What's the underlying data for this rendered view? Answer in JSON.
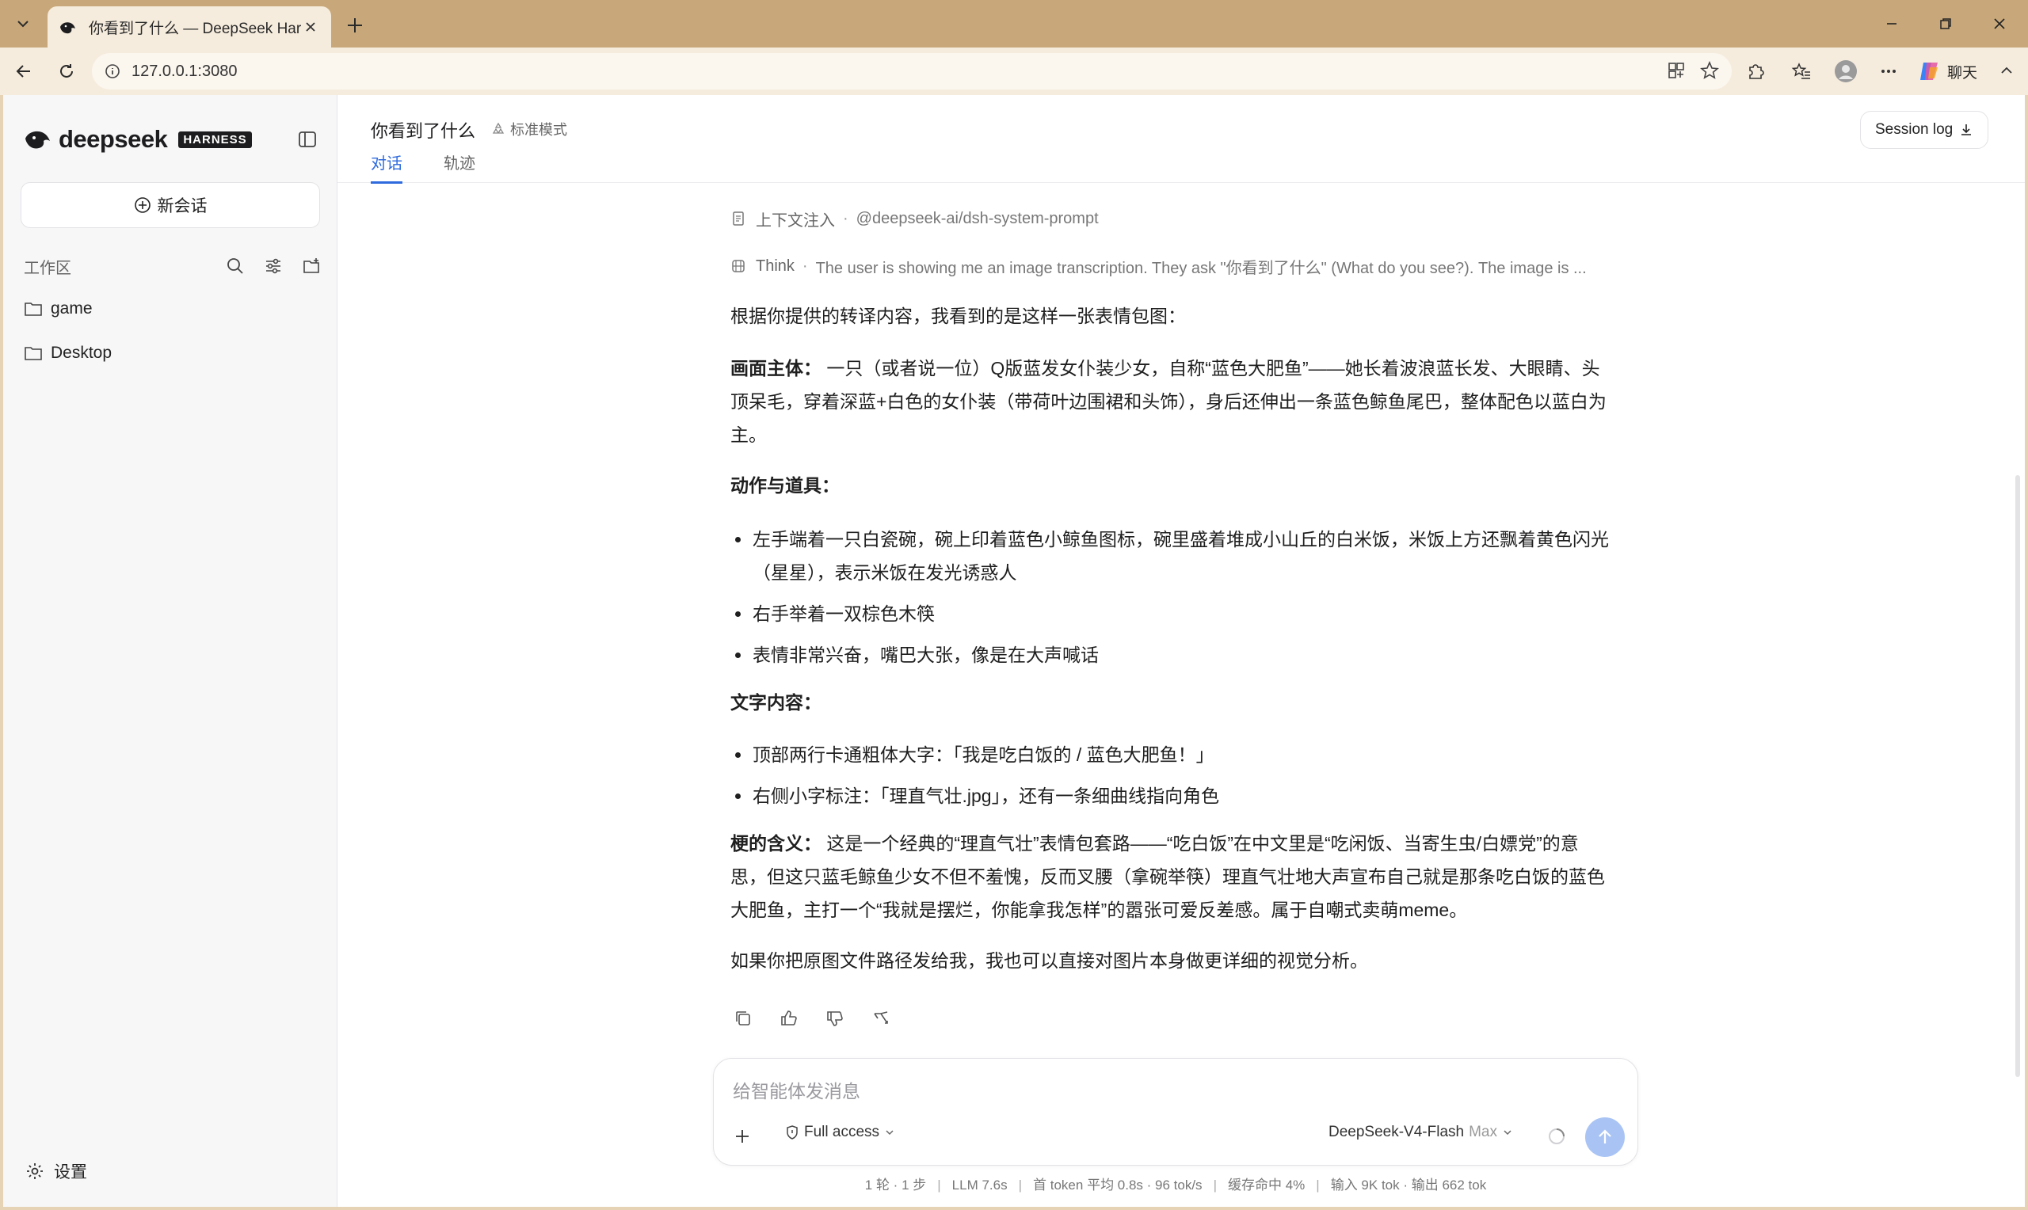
{
  "browser": {
    "tab_title": "你看到了什么 — DeepSeek Harness",
    "url": "127.0.0.1:3080",
    "copilot_label": "聊天"
  },
  "sidebar": {
    "brand": "deepseek",
    "badge": "HARNESS",
    "new_session": "新会话",
    "workspace_label": "工作区",
    "items": [
      {
        "label": "game"
      },
      {
        "label": "Desktop"
      }
    ],
    "settings": "设置"
  },
  "header": {
    "title": "你看到了什么",
    "mode": "标准模式",
    "tabs": [
      {
        "label": "对话"
      },
      {
        "label": "轨迹"
      }
    ],
    "session_log": "Session log"
  },
  "message": {
    "context_label": "上下文注入",
    "context_value": "@deepseek-ai/dsh-system-prompt",
    "think_label": "Think",
    "think_preview": "The user is showing me an image transcription. They ask \"你看到了什么\" (What do you see?). The image is ...",
    "intro": "根据你提供的转译内容，我看到的是这样一张表情包图：",
    "subject_head": "画面主体：",
    "subject_text": "一只（或者说一位）Q版蓝发女仆装少女，自称“蓝色大肥鱼”——她长着波浪蓝长发、大眼睛、头顶呆毛，穿着深蓝+白色的女仆装（带荷叶边围裙和头饰），身后还伸出一条蓝色鲸鱼尾巴，整体配色以蓝白为主。",
    "actions_head": "动作与道具：",
    "actions": [
      "左手端着一只白瓷碗，碗上印着蓝色小鲸鱼图标，碗里盛着堆成小山丘的白米饭，米饭上方还飘着黄色闪光（星星），表示米饭在发光诱惑人",
      "右手举着一双棕色木筷",
      "表情非常兴奋，嘴巴大张，像是在大声喊话"
    ],
    "text_head": "文字内容：",
    "texts": [
      "顶部两行卡通粗体大字：「我是吃白饭的 / 蓝色大肥鱼！」",
      "右侧小字标注：「理直气壮.jpg」，还有一条细曲线指向角色"
    ],
    "meaning_head": "梗的含义：",
    "meaning_text": "这是一个经典的“理直气壮”表情包套路——“吃白饭”在中文里是“吃闲饭、当寄生虫/白嫖党”的意思，但这只蓝毛鲸鱼少女不但不羞愧，反而叉腰（拿碗举筷）理直气壮地大声宣布自己就是那条吃白饭的蓝色大肥鱼，主打一个“我就是摆烂，你能拿我怎样”的嚣张可爱反差感。属于自嘲式卖萌meme。",
    "outro": "如果你把原图文件路径发给我，我也可以直接对图片本身做更详细的视觉分析。"
  },
  "composer": {
    "placeholder": "给智能体发消息",
    "access": "Full access",
    "model": "DeepSeek-V4-Flash",
    "level": "Max"
  },
  "stats": {
    "turns": "1 轮 · 1 步",
    "llm": "LLM 7.6s",
    "first_token": "首 token 平均 0.8s · 96 tok/s",
    "cache": "缓存命中 4%",
    "io": "输入 9K tok · 输出 662 tok"
  },
  "colors": {
    "accent": "#2f6bde",
    "chrome": "#c8a87a",
    "toolbar": "#f6ecdd",
    "send": "#a9c4f4"
  }
}
